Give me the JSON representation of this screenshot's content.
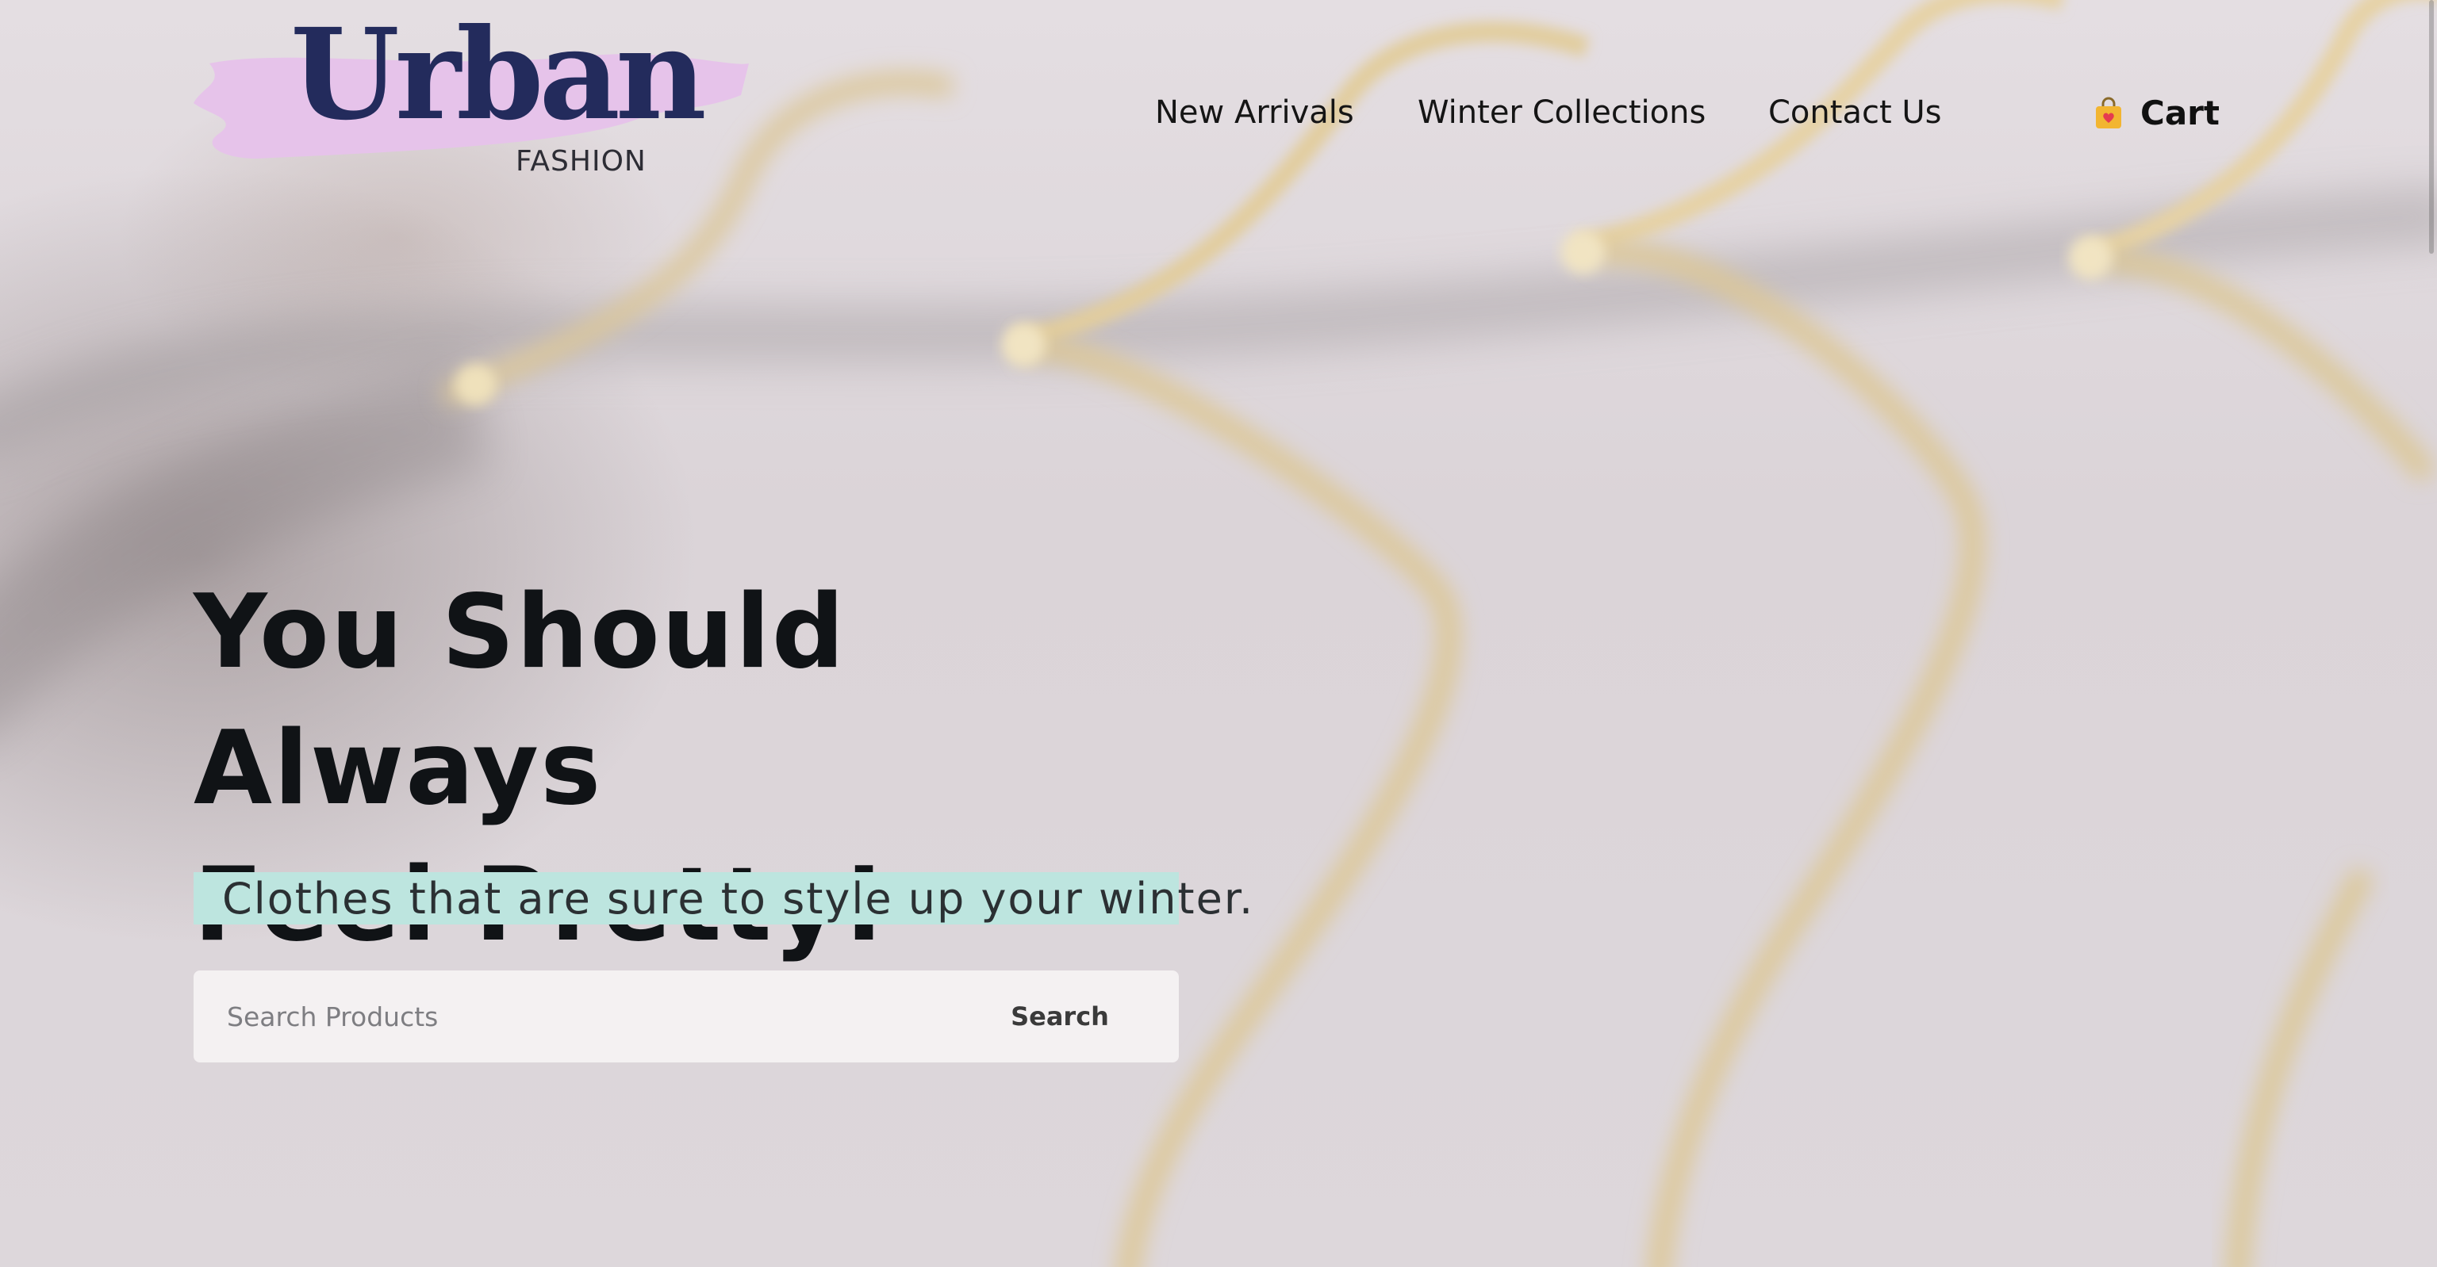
{
  "brand": {
    "name": "Urban",
    "subtitle": "FASHION",
    "swash_color": "#e6c3ea",
    "name_color": "#232b5c"
  },
  "nav": {
    "links": [
      {
        "label": "New Arrivals"
      },
      {
        "label": "Winter Collections"
      },
      {
        "label": "Contact Us"
      }
    ],
    "cart": {
      "label": "Cart",
      "icon": "shopping-bag-heart-icon"
    }
  },
  "hero": {
    "title_line1": "You Should Always",
    "title_line2": "Feel Pretty!",
    "tagline": "Clothes that are sure to style up your winter.",
    "tagline_highlight": "#bde5df"
  },
  "search": {
    "placeholder": "Search Products",
    "value": "",
    "button_label": "Search"
  },
  "background": {
    "description_icon": "clothes-hangers-image",
    "accent": "#d8c08a"
  }
}
